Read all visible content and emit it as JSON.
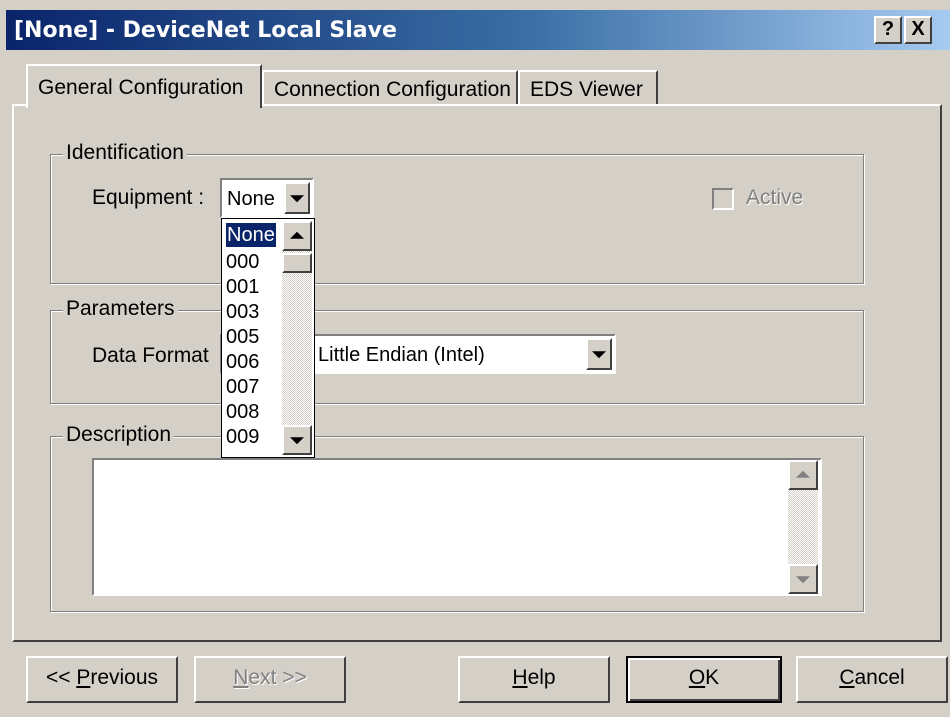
{
  "window": {
    "title": "[None] - DeviceNet Local Slave",
    "help_label": "?",
    "close_label": "X"
  },
  "tabs": [
    {
      "label": "General Configuration"
    },
    {
      "label": "Connection Configuration"
    },
    {
      "label": "EDS Viewer"
    }
  ],
  "identification": {
    "group_label": "Identification",
    "equipment_label": "Equipment :",
    "equipment_value": "None",
    "active_label": "Active",
    "active_checked": false,
    "dropdown_options": [
      "None",
      "000",
      "001",
      "003",
      "005",
      "006",
      "007",
      "008",
      "009"
    ]
  },
  "parameters": {
    "group_label": "Parameters",
    "data_format_label": "Data Format",
    "data_format_value": "Little Endian (Intel)"
  },
  "description": {
    "group_label": "Description",
    "text": ""
  },
  "buttons": {
    "previous_prefix": "<< ",
    "previous_ul": "P",
    "previous_rest": "revious",
    "next_ul": "N",
    "next_rest": "ext >>",
    "help_ul": "H",
    "help_rest": "elp",
    "ok_ul": "O",
    "ok_rest": "K",
    "cancel_ul": "C",
    "cancel_rest": "ancel"
  }
}
